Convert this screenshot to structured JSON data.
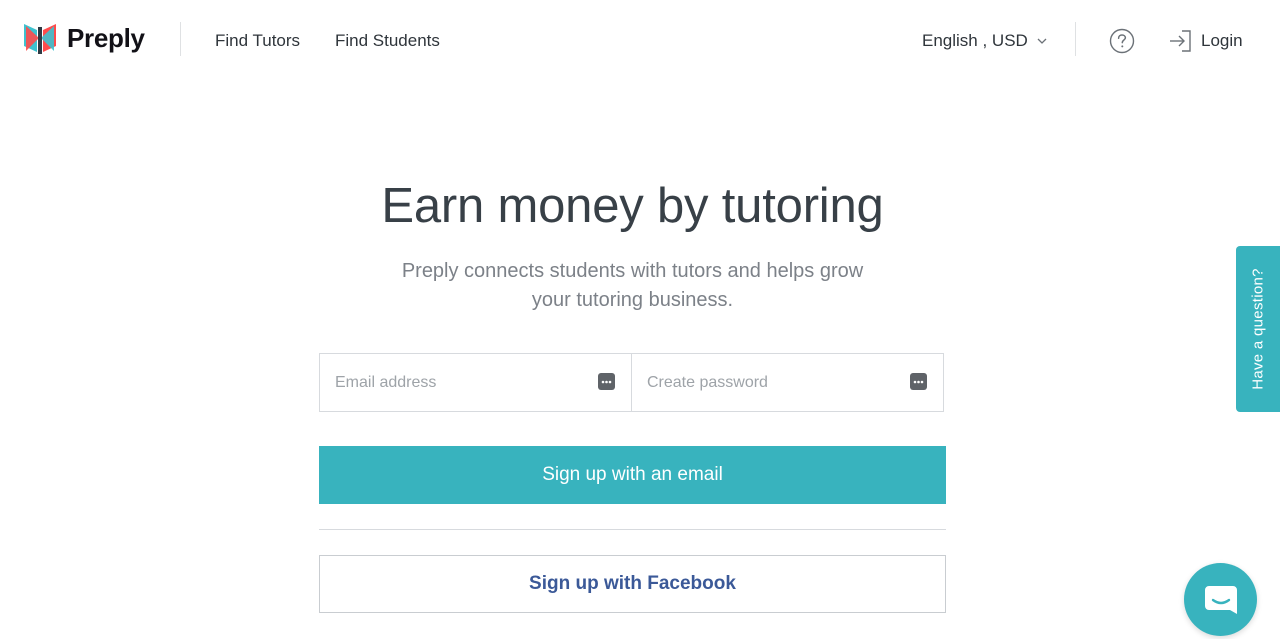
{
  "brand": {
    "name": "Preply"
  },
  "nav": {
    "find_tutors": "Find Tutors",
    "find_students": "Find Students",
    "language_currency": "English , USD",
    "login": "Login"
  },
  "hero": {
    "title": "Earn money by tutoring",
    "subtitle": "Preply connects students with tutors and helps grow your tutoring business."
  },
  "form": {
    "email_placeholder": "Email address",
    "password_placeholder": "Create password",
    "signup_email_label": "Sign up with an email",
    "signup_facebook_label": "Sign up with Facebook"
  },
  "side_tab": {
    "label": "Have a question?"
  },
  "colors": {
    "accent": "#38b3be",
    "facebook": "#3b5998",
    "logo_red": "#ff4b4b",
    "logo_teal": "#3ec2cf"
  },
  "icons": {
    "help": "help-circle-icon",
    "login": "login-arrow-icon",
    "chevron": "chevron-down-icon",
    "password_manager": "password-dots-icon",
    "chat": "chat-bubble-icon"
  }
}
